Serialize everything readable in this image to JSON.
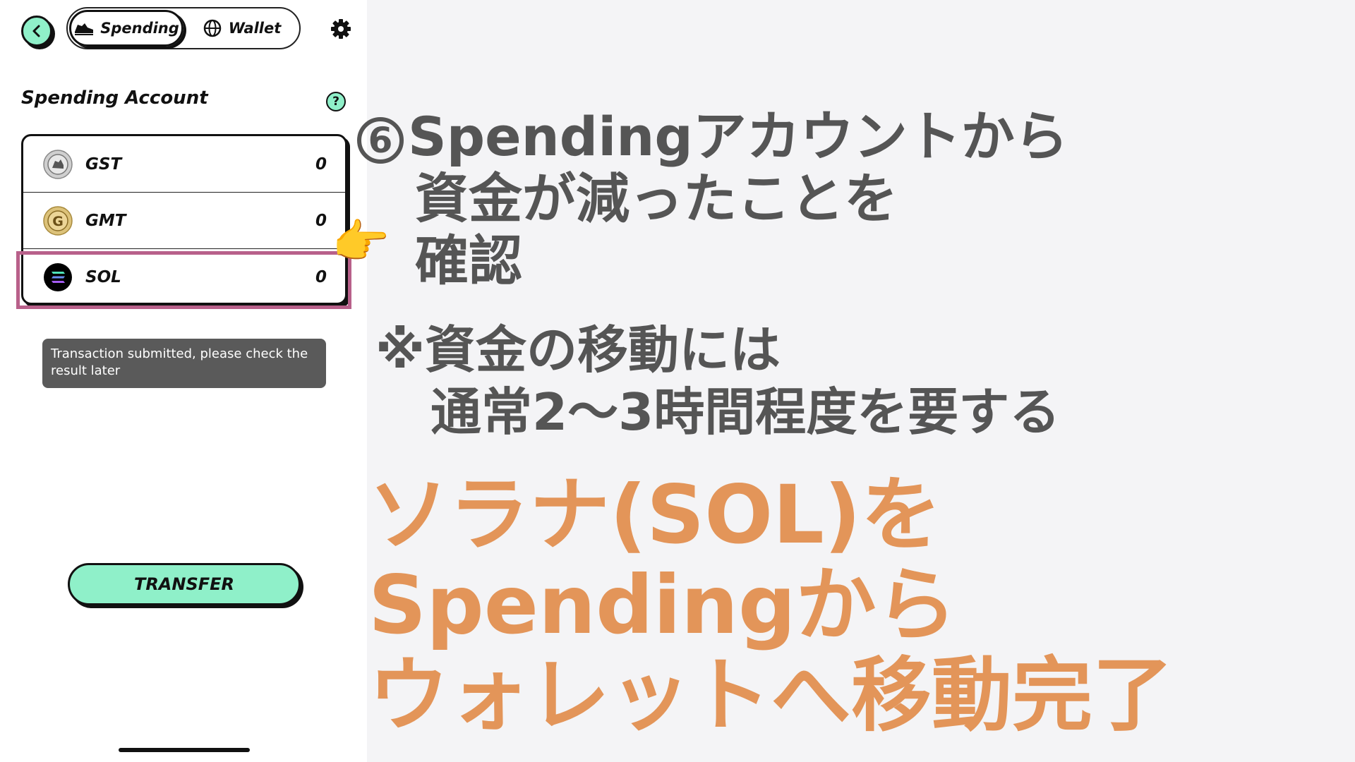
{
  "header": {
    "tabs": [
      {
        "label": "Spending",
        "icon": "sneaker-icon",
        "active": true
      },
      {
        "label": "Wallet",
        "icon": "globe-icon",
        "active": false
      }
    ]
  },
  "account": {
    "title": "Spending Account",
    "help": "?",
    "tokens": [
      {
        "name": "GST",
        "value": "0",
        "icon": "gst-coin-icon"
      },
      {
        "name": "GMT",
        "value": "0",
        "icon": "gmt-coin-icon"
      },
      {
        "name": "SOL",
        "value": "0",
        "icon": "sol-coin-icon"
      }
    ]
  },
  "toast": "Transaction submitted, please check the result later",
  "transfer_button": "TRANSFER",
  "annotation": {
    "step_number": "6",
    "step_line1": "Spendingアカウントから",
    "step_line2": "資金が減ったことを",
    "step_line3": "確認",
    "note_line1": "※資金の移動には",
    "note_line2": "通常2〜3時間程度を要する",
    "headline_line1": "ソラナ(SOL)を",
    "headline_line2": "Spendingから",
    "headline_line3": "ウォレットへ移動完了"
  },
  "colors": {
    "accent": "#8ff0c9",
    "highlight": "#b8608a",
    "annotation_gray": "#555555",
    "annotation_orange": "#e39559"
  }
}
